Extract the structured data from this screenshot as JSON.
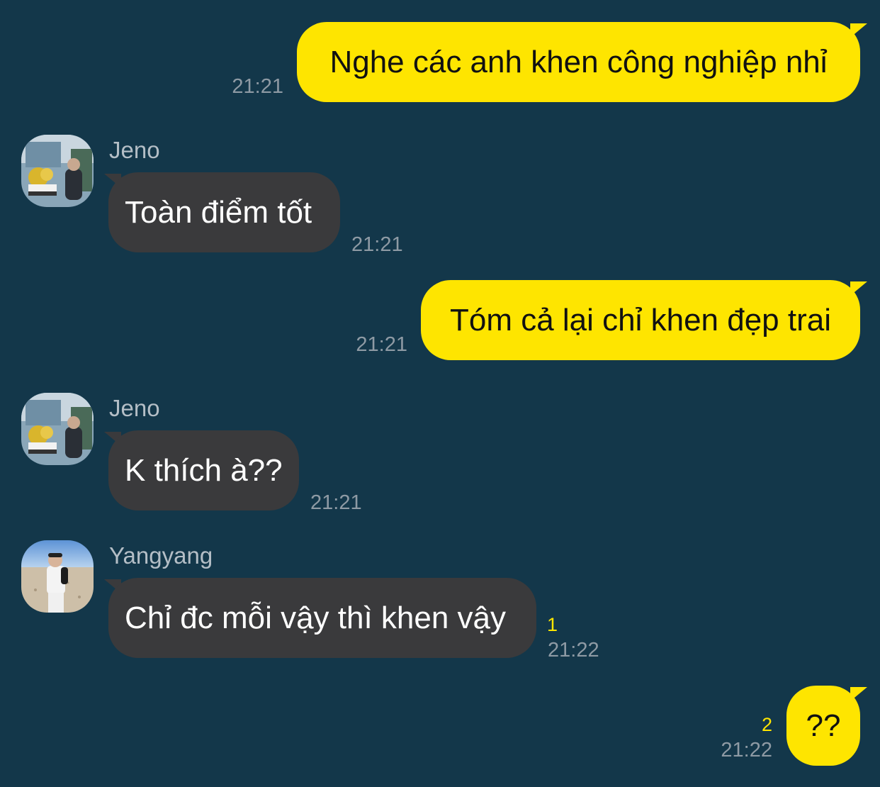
{
  "colors": {
    "background": "#13374a",
    "outgoing_bubble": "#fee500",
    "incoming_bubble": "#3a3a3c",
    "unread_count": "#fee500"
  },
  "messages": [
    {
      "direction": "outgoing",
      "text": "Nghe các anh khen công nghiệp nhỉ",
      "time": "21:21"
    },
    {
      "direction": "incoming",
      "sender": "Jeno",
      "avatar": "jeno-avatar-photo",
      "text": "Toàn điểm tốt",
      "time": "21:21"
    },
    {
      "direction": "outgoing",
      "text": "Tóm cả lại chỉ khen đẹp trai",
      "time": "21:21"
    },
    {
      "direction": "incoming",
      "sender": "Jeno",
      "avatar": "jeno-avatar-photo",
      "text": "K thích à??",
      "time": "21:21"
    },
    {
      "direction": "incoming",
      "sender": "Yangyang",
      "avatar": "yangyang-avatar-photo",
      "text": "Chỉ đc mỗi vậy thì khen vậy",
      "unread": "1",
      "time": "21:22"
    },
    {
      "direction": "outgoing",
      "text": "??",
      "unread": "2",
      "time": "21:22"
    }
  ]
}
